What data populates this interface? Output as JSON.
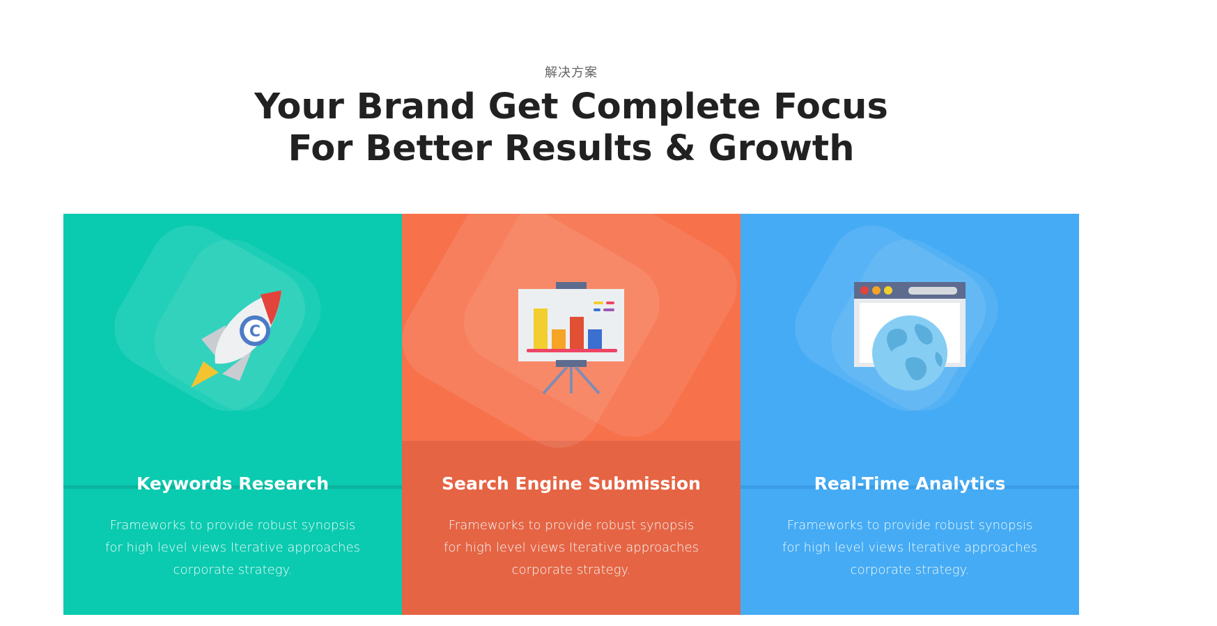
{
  "header": {
    "eyebrow": "解决方案",
    "title_line1": "Your Brand Get Complete Focus",
    "title_line2": "For Better Results & Growth"
  },
  "cards": [
    {
      "title": "Keywords Research",
      "description": "Frameworks to provide robust synopsis for high level views Iterative approaches corporate strategy.",
      "icon": "rocket-icon",
      "color": "#0acab0"
    },
    {
      "title": "Search Engine Submission",
      "description": "Frameworks to provide robust synopsis for high level views Iterative approaches corporate strategy.",
      "icon": "presentation-chart-icon",
      "color": "#f7714b"
    },
    {
      "title": "Real-Time Analytics",
      "description": "Frameworks to provide robust synopsis for high level views Iterative approaches corporate strategy.",
      "icon": "browser-globe-icon",
      "color": "#45abf4"
    }
  ]
}
